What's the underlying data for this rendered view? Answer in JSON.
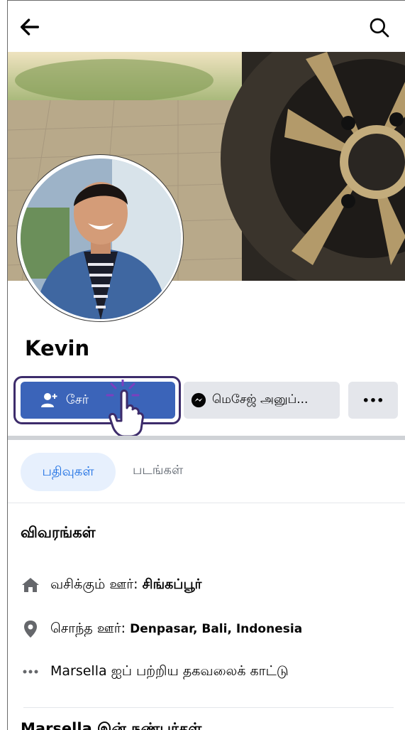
{
  "header": {
    "back_icon": "arrow-left-icon",
    "search_icon": "search-icon"
  },
  "profile": {
    "name": "Kevin"
  },
  "actions": {
    "add_label": "சேர்",
    "message_label": "மெசேஜ் அனுப்...",
    "more_label": "•••"
  },
  "tabs": {
    "posts": "பதிவுகள்",
    "photos": "படங்கள்"
  },
  "about": {
    "title": "விவரங்கள்",
    "lives_label": "வசிக்கும் ஊர்:",
    "lives_value": "சிங்கப்பூர்",
    "from_label": "சொந்த ஊர்:",
    "from_value": "Denpasar, Bali, Indonesia",
    "more_info": "Marsella ஐப் பற்றிய தகவலைக் காட்டு"
  },
  "friends": {
    "title": "Marsella இன் நண்பர்கள்"
  },
  "colors": {
    "primary": "#3b64b9",
    "secondary_button": "#e4e6eb",
    "tab_active_bg": "#e7f0fd",
    "tab_active_text": "#1b6ee3",
    "highlight_border": "#3d2c6b"
  }
}
